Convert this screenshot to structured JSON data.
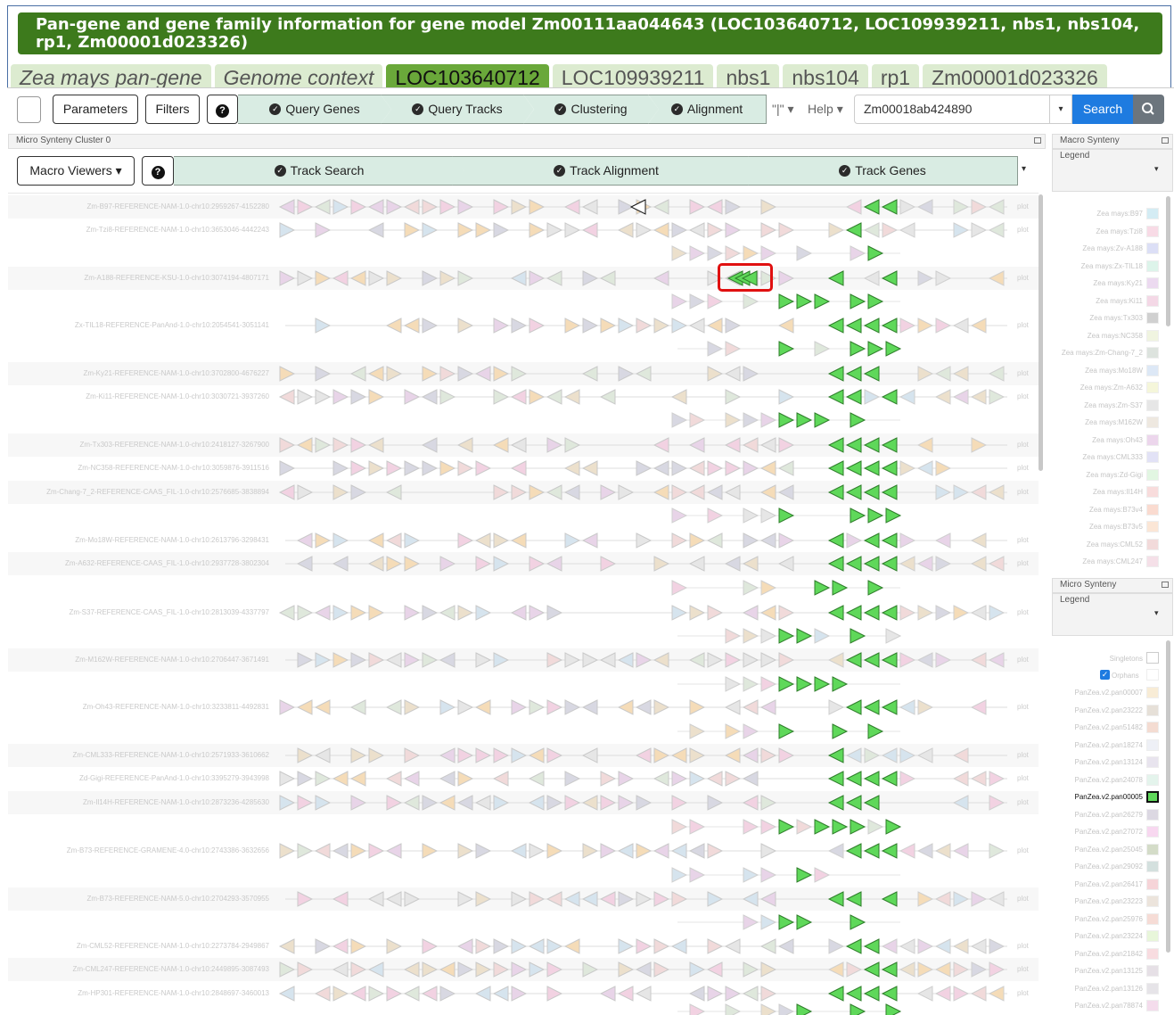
{
  "header": {
    "title": "Pan-gene and gene family information for gene model Zm00111aa044643 (LOC103640712, LOC109939211, nbs1, nbs104, rp1, Zm00001d023326)"
  },
  "tabs": [
    "Zea mays pan-gene",
    "Genome context",
    "LOC103640712",
    "LOC109939211",
    "nbs1",
    "nbs104",
    "rp1",
    "Zm00001d023326"
  ],
  "toolbar": {
    "parameters": "Parameters",
    "filters": "Filters",
    "help_icon": "?",
    "steps": [
      "Query Genes",
      "Query Tracks",
      "Clustering",
      "Alignment"
    ],
    "pipeline_icon": "\"|\"",
    "help": "Help",
    "search_value": "Zm00018ab424890",
    "search": "Search"
  },
  "micro_panel": {
    "title": "Micro Synteny Cluster 0",
    "macro_viewers": "Macro Viewers",
    "help_icon": "?",
    "steps": [
      "Track Search",
      "Track Alignment",
      "Track Genes"
    ]
  },
  "tracks": [
    {
      "label": "Zm-B97-REFERENCE-NAM-1.0-chr10:2959267-4152280",
      "plot": "plot"
    },
    {
      "label": "Zm-Tzi8-REFERENCE-NAM-1.0-chr10:3653046-4442243",
      "plot": "plot"
    },
    {
      "label": "Zm-A188-REFERENCE-KSU-1.0-chr10:3074194-4807171",
      "plot": "plot"
    },
    {
      "label": "Zx-TIL18-REFERENCE-PanAnd-1.0-chr10:2054541-3051141",
      "plot": "plot"
    },
    {
      "label": "Zm-Ky21-REFERENCE-NAM-1.0-chr10:3702800-4676227",
      "plot": "plot"
    },
    {
      "label": "Zm-Ki11-REFERENCE-NAM-1.0-chr10:3030721-3937260",
      "plot": "plot"
    },
    {
      "label": "Zm-Tx303-REFERENCE-NAM-1.0-chr10:2418127-3267900",
      "plot": "plot"
    },
    {
      "label": "Zm-NC358-REFERENCE-NAM-1.0-chr10:3059876-3911516",
      "plot": "plot"
    },
    {
      "label": "Zm-Chang-7_2-REFERENCE-CAAS_FIL-1.0-chr10:2576685-3838894",
      "plot": "plot"
    },
    {
      "label": "Zm-Mo18W-REFERENCE-NAM-1.0-chr10:2613796-3298431",
      "plot": "plot"
    },
    {
      "label": "Zm-A632-REFERENCE-CAAS_FIL-1.0-chr10:2937728-3802304",
      "plot": "plot"
    },
    {
      "label": "Zm-S37-REFERENCE-CAAS_FIL-1.0-chr10:2813039-4337797",
      "plot": "plot"
    },
    {
      "label": "Zm-M162W-REFERENCE-NAM-1.0-chr10:2706447-3671491",
      "plot": "plot"
    },
    {
      "label": "Zm-Oh43-REFERENCE-NAM-1.0-chr10:3233811-4492831",
      "plot": "plot"
    },
    {
      "label": "Zm-CML333-REFERENCE-NAM-1.0-chr10:2571933-3610662",
      "plot": "plot"
    },
    {
      "label": "Zd-Gigi-REFERENCE-PanAnd-1.0-chr10:3395279-3943998",
      "plot": "plot"
    },
    {
      "label": "Zm-Il14H-REFERENCE-NAM-1.0-chr10:2873236-4285630",
      "plot": "plot"
    },
    {
      "label": "Zm-B73-REFERENCE-GRAMENE-4.0-chr10:2743386-3632656",
      "plot": "plot"
    },
    {
      "label": "Zm-B73-REFERENCE-NAM-5.0-chr10:2704293-3570955",
      "plot": "plot"
    },
    {
      "label": "Zm-CML52-REFERENCE-NAM-1.0-chr10:2273784-2949867",
      "plot": "plot"
    },
    {
      "label": "Zm-CML247-REFERENCE-NAM-1.0-chr10:2449895-3087493",
      "plot": "plot"
    },
    {
      "label": "Zm-HP301-REFERENCE-NAM-1.0-chr10:2848697-3460013",
      "plot": "plot"
    }
  ],
  "macro_legend": {
    "title": "Macro Synteny",
    "legend": "Legend",
    "items": [
      "Zea mays:B97",
      "Zea mays:Tzi8",
      "Zea mays:Zv-A188",
      "Zea mays:Zx-TIL18",
      "Zea mays:Ky21",
      "Zea mays:Ki11",
      "Zea mays:Tx303",
      "Zea mays:NC358",
      "Zea mays:Zm-Chang-7_2",
      "Zea mays:Mo18W",
      "Zea mays:Zm-A632",
      "Zea mays:Zm-S37",
      "Zea mays:M162W",
      "Zea mays:Oh43",
      "Zea mays:CML333",
      "Zea mays:Zd-Gigi",
      "Zea mays:Il14H",
      "Zea mays:B73v4",
      "Zea mays:B73v5",
      "Zea mays:CML52",
      "Zea mays:CML247"
    ],
    "colors": [
      "#d4ecf4",
      "#f8dbe6",
      "#dcdff6",
      "#ddf4ea",
      "#ecdaf0",
      "#f4d8e6",
      "#d0d0d0",
      "#f0f4e0",
      "#dde3de",
      "#dde8f6",
      "#f5f6da",
      "#e6e6e6",
      "#eee8e0",
      "#ecd6ec",
      "#e2e2f6",
      "#e2f6e2",
      "#f8dcdc",
      "#fadbd0",
      "#fbe6d6",
      "#f2dada",
      "#f5e0e8"
    ]
  },
  "micro_legend": {
    "title": "Micro Synteny",
    "legend": "Legend",
    "singletons": "Singletons",
    "orphans": "Orphans",
    "items": [
      "PanZea.v2.pan00007",
      "PanZea.v2.pan23222",
      "PanZea.v2.pan51482",
      "PanZea.v2.pan18274",
      "PanZea.v2.pan13124",
      "PanZea.v2.pan24078",
      "PanZea.v2.pan00005",
      "PanZea.v2.pan26279",
      "PanZea.v2.pan27072",
      "PanZea.v2.pan25045",
      "PanZea.v2.pan29092",
      "PanZea.v2.pan26417",
      "PanZea.v2.pan23223",
      "PanZea.v2.pan25976",
      "PanZea.v2.pan23224",
      "PanZea.v2.pan21842",
      "PanZea.v2.pan13125",
      "PanZea.v2.pan13126",
      "PanZea.v2.pan78874"
    ],
    "colors": [
      "#f8ecd6",
      "#e6e0d8",
      "#f4dcd2",
      "#eef0f6",
      "#e8e4ee",
      "#e4f4ec",
      "#5fd85a",
      "#dcd8e2",
      "#f8d8f0",
      "#d4dcc8",
      "#d4e0de",
      "#f6d4d8",
      "#ece4dc",
      "#f6dcd6",
      "#e8f6da",
      "#f8dce0",
      "#e6e0e6",
      "#e6e4e8",
      "#f4dcec"
    ]
  }
}
